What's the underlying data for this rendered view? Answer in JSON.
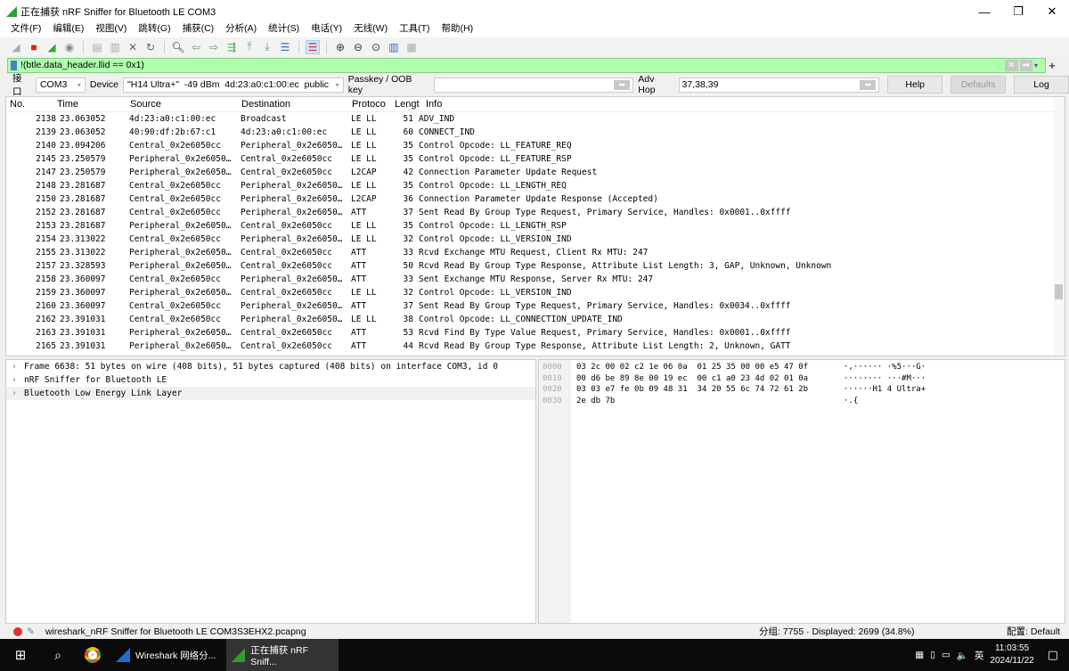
{
  "window": {
    "title": "正在捕获 nRF Sniffer for Bluetooth LE COM3",
    "min": "—",
    "max": "❐",
    "close": "✕"
  },
  "menu": [
    "文件(F)",
    "编辑(E)",
    "视图(V)",
    "跳转(G)",
    "捕获(C)",
    "分析(A)",
    "统计(S)",
    "电话(Y)",
    "无线(W)",
    "工具(T)",
    "帮助(H)"
  ],
  "toolbar_icons": [
    "shark-fin-start-icon",
    "stop-icon",
    "restart-icon",
    "options-icon",
    "|",
    "open-icon",
    "save-icon",
    "close-file-icon",
    "reload-icon",
    "|",
    "find-icon",
    "back-icon",
    "forward-icon",
    "goto-icon",
    "first-icon",
    "last-icon",
    "autoscroll-icon",
    "|",
    "colorize-icon",
    "|",
    "zoom-in-icon",
    "zoom-out-icon",
    "zoom-reset-icon",
    "resize-columns-icon",
    "layout-icon"
  ],
  "filter": {
    "value": "!(btle.data_header.llid == 0x1)",
    "color": "#afffaf"
  },
  "interface": {
    "label": "接口",
    "port": "COM3",
    "device_label": "Device",
    "device": "\"H14 Ultra+\"  -49 dBm  4d:23:a0:c1:00:ec  public",
    "passkey_label": "Passkey / OOB key",
    "passkey": "",
    "advhop_label": "Adv Hop",
    "advhop": "37,38,39",
    "help": "Help",
    "defaults": "Defaults",
    "log": "Log"
  },
  "columns": [
    "No.",
    "Time",
    "Source",
    "Destination",
    "Protoco",
    "Lengt",
    "Info"
  ],
  "packets": [
    [
      "2138",
      "23.063052",
      "4d:23:a0:c1:00:ec",
      "Broadcast",
      "LE LL",
      "51",
      "ADV_IND"
    ],
    [
      "2139",
      "23.063052",
      "40:90:df:2b:67:c1",
      "4d:23:a0:c1:00:ec",
      "LE LL",
      "60",
      "CONNECT_IND"
    ],
    [
      "2140",
      "23.094206",
      "Central_0x2e6050cc",
      "Peripheral_0x2e6050…",
      "LE LL",
      "35",
      "Control Opcode: LL_FEATURE_REQ"
    ],
    [
      "2145",
      "23.250579",
      "Peripheral_0x2e6050…",
      "Central_0x2e6050cc",
      "LE LL",
      "35",
      "Control Opcode: LL_FEATURE_RSP"
    ],
    [
      "2147",
      "23.250579",
      "Peripheral_0x2e6050…",
      "Central_0x2e6050cc",
      "L2CAP",
      "42",
      "Connection Parameter Update Request"
    ],
    [
      "2148",
      "23.281687",
      "Central_0x2e6050cc",
      "Peripheral_0x2e6050…",
      "LE LL",
      "35",
      "Control Opcode: LL_LENGTH_REQ"
    ],
    [
      "2150",
      "23.281687",
      "Central_0x2e6050cc",
      "Peripheral_0x2e6050…",
      "L2CAP",
      "36",
      "Connection Parameter Update Response (Accepted)"
    ],
    [
      "2152",
      "23.281687",
      "Central_0x2e6050cc",
      "Peripheral_0x2e6050…",
      "ATT",
      "37",
      "Sent Read By Group Type Request, Primary Service, Handles: 0x0001..0xffff"
    ],
    [
      "2153",
      "23.281687",
      "Peripheral_0x2e6050…",
      "Central_0x2e6050cc",
      "LE LL",
      "35",
      "Control Opcode: LL_LENGTH_RSP"
    ],
    [
      "2154",
      "23.313022",
      "Central_0x2e6050cc",
      "Peripheral_0x2e6050…",
      "LE LL",
      "32",
      "Control Opcode: LL_VERSION_IND"
    ],
    [
      "2155",
      "23.313022",
      "Peripheral_0x2e6050…",
      "Central_0x2e6050cc",
      "ATT",
      "33",
      "Rcvd Exchange MTU Request, Client Rx MTU: 247"
    ],
    [
      "2157",
      "23.328593",
      "Peripheral_0x2e6050…",
      "Central_0x2e6050cc",
      "ATT",
      "50",
      "Rcvd Read By Group Type Response, Attribute List Length: 3, GAP, Unknown, Unknown"
    ],
    [
      "2158",
      "23.360097",
      "Central_0x2e6050cc",
      "Peripheral_0x2e6050…",
      "ATT",
      "33",
      "Sent Exchange MTU Response, Server Rx MTU: 247"
    ],
    [
      "2159",
      "23.360097",
      "Peripheral_0x2e6050…",
      "Central_0x2e6050cc",
      "LE LL",
      "32",
      "Control Opcode: LL_VERSION_IND"
    ],
    [
      "2160",
      "23.360097",
      "Central_0x2e6050cc",
      "Peripheral_0x2e6050…",
      "ATT",
      "37",
      "Sent Read By Group Type Request, Primary Service, Handles: 0x0034..0xffff"
    ],
    [
      "2162",
      "23.391031",
      "Central_0x2e6050cc",
      "Peripheral_0x2e6050…",
      "LE LL",
      "38",
      "Control Opcode: LL_CONNECTION_UPDATE_IND"
    ],
    [
      "2163",
      "23.391031",
      "Peripheral_0x2e6050…",
      "Central_0x2e6050cc",
      "ATT",
      "53",
      "Rcvd Find By Type Value Request, Primary Service, Handles: 0x0001..0xffff"
    ],
    [
      "2165",
      "23.391031",
      "Peripheral_0x2e6050…",
      "Central_0x2e6050cc",
      "ATT",
      "44",
      "Rcvd Read By Group Type Response, Attribute List Length: 2, Unknown, GATT"
    ]
  ],
  "details": [
    "Frame 6638: 51 bytes on wire (408 bits), 51 bytes captured (408 bits) on interface COM3, id 0",
    "nRF Sniffer for Bluetooth LE",
    "Bluetooth Low Energy Link Layer"
  ],
  "hex": [
    [
      "0000",
      "03 2c 00 02 c2 1e 06 0a  01 25 35 00 00 e5 47 0f",
      "·,······ ·%5···G·"
    ],
    [
      "0010",
      "00 d6 be 89 8e 00 19 ec  00 c1 a0 23 4d 02 01 0a",
      "········ ···#M···"
    ],
    [
      "0020",
      "03 03 e7 fe 0b 09 48 31  34 20 55 6c 74 72 61 2b",
      "······H1 4 Ultra+"
    ],
    [
      "0030",
      "2e db 7b",
      "·.{"
    ]
  ],
  "status": {
    "file": "wireshark_nRF Sniffer for Bluetooth LE COM3S3EHX2.pcapng",
    "counts": "分组: 7755 · Displayed: 2699 (34.8%)",
    "profile": "配置: Default"
  },
  "taskbar": {
    "items": [
      "Wireshark 网络分...",
      "正在捕获 nRF Sniff..."
    ],
    "ime": "英",
    "time": "11:03:55",
    "date": "2024/11/22"
  }
}
